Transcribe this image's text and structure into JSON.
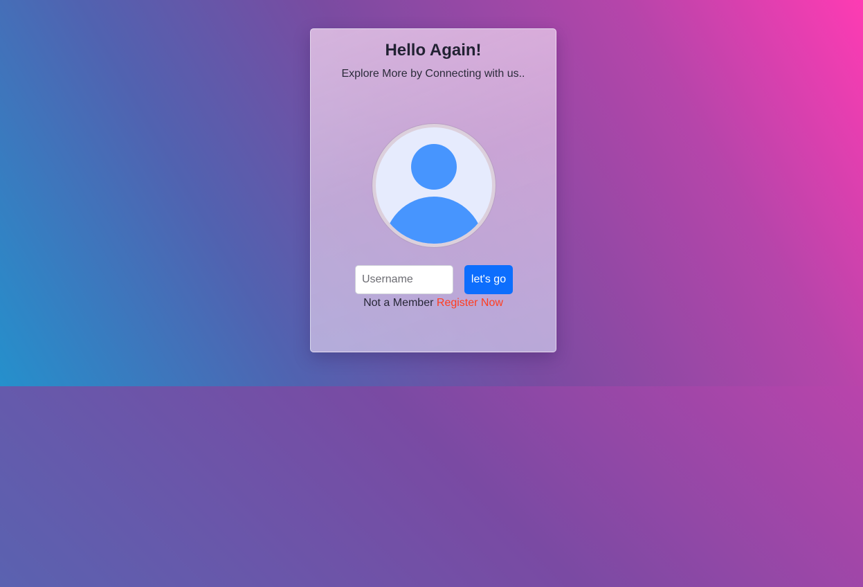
{
  "card": {
    "title": "Hello Again!",
    "subtitle": "Explore More by Connecting with us.."
  },
  "avatar": {
    "icon": "user-avatar-icon"
  },
  "form": {
    "username_placeholder": "Username",
    "username_value": "",
    "submit_label": "let's go"
  },
  "register": {
    "prompt": "Not a Member",
    "link_label": "Register Now"
  },
  "colors": {
    "primary_button": "#0d6efd",
    "register_link": "#ff3d1f",
    "avatar_figure": "#4795fe",
    "avatar_background": "#e6ebfd"
  }
}
